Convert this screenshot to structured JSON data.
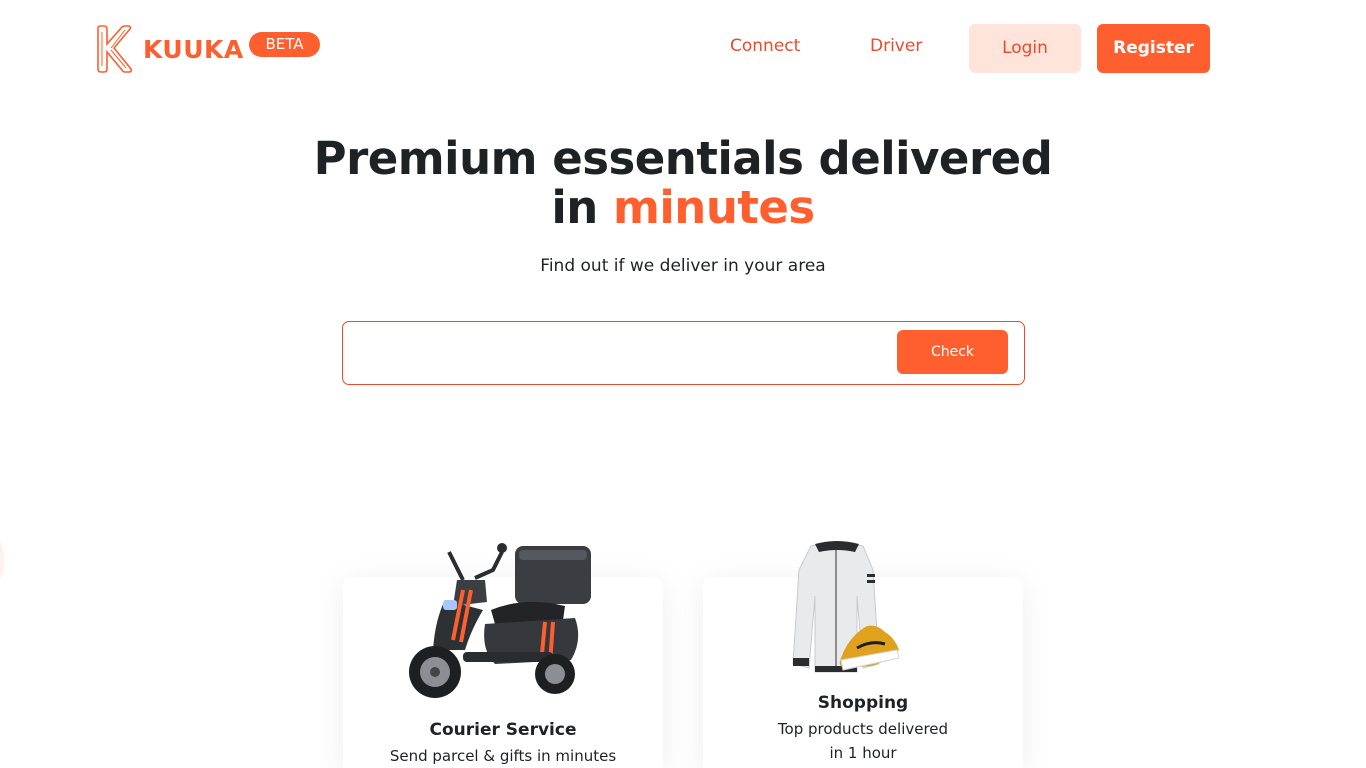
{
  "header": {
    "brand": "KUUKA",
    "badge": "BETA",
    "nav": {
      "connect": "Connect",
      "driver": "Driver",
      "login": "Login",
      "register": "Register"
    }
  },
  "hero": {
    "title_line1": "Premium essentials delivered",
    "title_line2_prefix": "in ",
    "title_line2_accent": "minutes",
    "subtitle": "Find out if we deliver in your area",
    "search_value": "",
    "check_label": "Check"
  },
  "cards": [
    {
      "title": "Courier Service",
      "description": "Send parcel & gifts in minutes",
      "icon": "scooter-image"
    },
    {
      "title": "Shopping",
      "description_line1": "Top products delivered",
      "description_line2": "in 1 hour",
      "icon": "apparel-image"
    }
  ],
  "colors": {
    "brand": "#ff5f2e",
    "link": "#ea4b2a",
    "login_bg": "#ffe4dc",
    "text": "#1f2225"
  }
}
